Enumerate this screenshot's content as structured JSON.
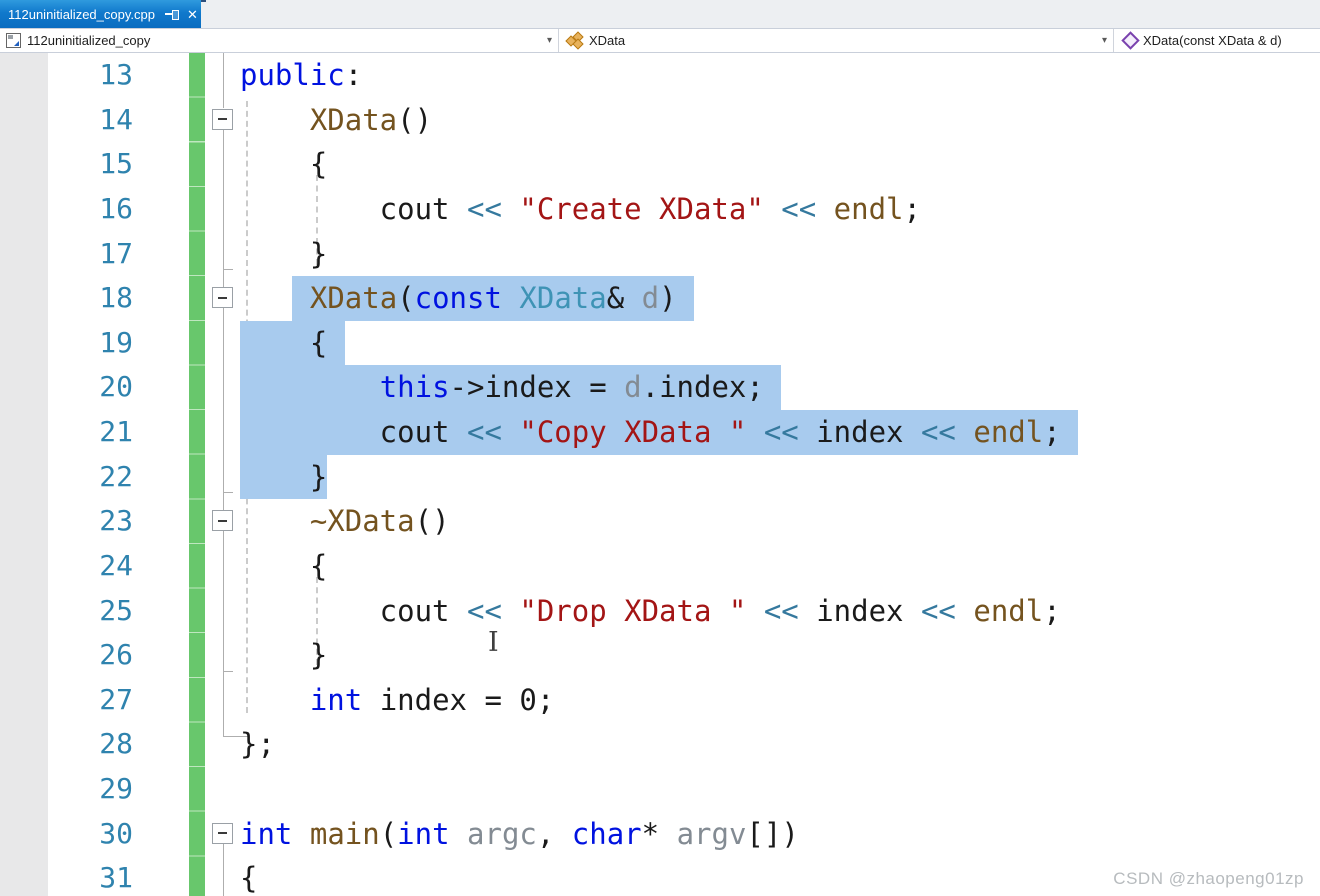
{
  "tab": {
    "title": "112uninitialized_copy.cpp",
    "close_glyph": "✕"
  },
  "navbar": {
    "scope_dropdown": {
      "label": "112uninitialized_copy",
      "icon": "cpp-project-item-icon",
      "arrow": "▾"
    },
    "type_dropdown": {
      "label": "XData",
      "icon": "class-icon",
      "arrow": "▾"
    },
    "member_dropdown": {
      "label": "XData(const XData & d)",
      "icon": "method-icon"
    }
  },
  "colors": {
    "tab_active_blue": "#0f76c8",
    "selection_blue": "#a8cbee",
    "change_bar_green": "#68c76c",
    "line_number_teal": "#2f83ae",
    "keyword": "#0012e0",
    "type": "#3e93b5",
    "function": "#74531f",
    "string": "#a31515",
    "operator": "#35799e",
    "parameter": "#838b93"
  },
  "editor": {
    "lines": [
      {
        "n": 13,
        "segments": [
          {
            "t": "public",
            "c": "keyword"
          },
          {
            "t": ":",
            "c": "plain"
          }
        ]
      },
      {
        "n": 14,
        "fold": true,
        "segments": [
          {
            "t": "    ",
            "c": "plain"
          },
          {
            "t": "XData",
            "c": "function"
          },
          {
            "t": "()",
            "c": "plain"
          }
        ]
      },
      {
        "n": 15,
        "segments": [
          {
            "t": "    {",
            "c": "plain"
          }
        ]
      },
      {
        "n": 16,
        "segments": [
          {
            "t": "        cout ",
            "c": "plain"
          },
          {
            "t": "<<",
            "c": "operator"
          },
          {
            "t": " ",
            "c": "plain"
          },
          {
            "t": "\"Create XData\"",
            "c": "string"
          },
          {
            "t": " ",
            "c": "plain"
          },
          {
            "t": "<<",
            "c": "operator"
          },
          {
            "t": " ",
            "c": "plain"
          },
          {
            "t": "endl",
            "c": "function"
          },
          {
            "t": ";",
            "c": "plain"
          }
        ]
      },
      {
        "n": 17,
        "segments": [
          {
            "t": "    }",
            "c": "plain"
          }
        ]
      },
      {
        "n": 18,
        "fold": true,
        "segments": [
          {
            "t": "   ",
            "c": "plain"
          },
          {
            "t": " ",
            "c": "plain",
            "sel": true
          },
          {
            "t": "XData",
            "c": "function",
            "sel": true
          },
          {
            "t": "(",
            "c": "plain",
            "sel": true
          },
          {
            "t": "const",
            "c": "keyword",
            "sel": true
          },
          {
            "t": " ",
            "c": "plain",
            "sel": true
          },
          {
            "t": "XData",
            "c": "type",
            "sel": true
          },
          {
            "t": "& ",
            "c": "plain",
            "sel": true
          },
          {
            "t": "d",
            "c": "param",
            "sel": true
          },
          {
            "t": ")",
            "c": "plain",
            "sel": true
          },
          {
            "t": " ",
            "c": "plain",
            "sel": true
          }
        ]
      },
      {
        "n": 19,
        "segments": [
          {
            "t": "    { ",
            "c": "plain",
            "sel": true
          }
        ]
      },
      {
        "n": 20,
        "segments": [
          {
            "t": "        ",
            "c": "plain",
            "sel": true
          },
          {
            "t": "this",
            "c": "keyword",
            "sel": true
          },
          {
            "t": "->index = ",
            "c": "plain",
            "sel": true
          },
          {
            "t": "d",
            "c": "param",
            "sel": true
          },
          {
            "t": ".index; ",
            "c": "plain",
            "sel": true
          }
        ]
      },
      {
        "n": 21,
        "segments": [
          {
            "t": "        cout ",
            "c": "plain",
            "sel": true
          },
          {
            "t": "<<",
            "c": "operator",
            "sel": true
          },
          {
            "t": " ",
            "c": "plain",
            "sel": true
          },
          {
            "t": "\"Copy XData \"",
            "c": "string",
            "sel": true
          },
          {
            "t": " ",
            "c": "plain",
            "sel": true
          },
          {
            "t": "<<",
            "c": "operator",
            "sel": true
          },
          {
            "t": " index ",
            "c": "plain",
            "sel": true
          },
          {
            "t": "<<",
            "c": "operator",
            "sel": true
          },
          {
            "t": " ",
            "c": "plain",
            "sel": true
          },
          {
            "t": "endl",
            "c": "function",
            "sel": true
          },
          {
            "t": "; ",
            "c": "plain",
            "sel": true
          }
        ]
      },
      {
        "n": 22,
        "segments": [
          {
            "t": "    }",
            "c": "plain",
            "sel": true
          }
        ]
      },
      {
        "n": 23,
        "fold": true,
        "segments": [
          {
            "t": "    ",
            "c": "plain"
          },
          {
            "t": "~XData",
            "c": "function"
          },
          {
            "t": "()",
            "c": "plain"
          }
        ]
      },
      {
        "n": 24,
        "segments": [
          {
            "t": "    {",
            "c": "plain"
          }
        ]
      },
      {
        "n": 25,
        "segments": [
          {
            "t": "        cout ",
            "c": "plain"
          },
          {
            "t": "<<",
            "c": "operator"
          },
          {
            "t": " ",
            "c": "plain"
          },
          {
            "t": "\"Drop XData \"",
            "c": "string"
          },
          {
            "t": " ",
            "c": "plain"
          },
          {
            "t": "<<",
            "c": "operator"
          },
          {
            "t": " index ",
            "c": "plain"
          },
          {
            "t": "<<",
            "c": "operator"
          },
          {
            "t": " ",
            "c": "plain"
          },
          {
            "t": "endl",
            "c": "function"
          },
          {
            "t": ";",
            "c": "plain"
          }
        ]
      },
      {
        "n": 26,
        "segments": [
          {
            "t": "    }",
            "c": "plain"
          }
        ]
      },
      {
        "n": 27,
        "segments": [
          {
            "t": "    ",
            "c": "plain"
          },
          {
            "t": "int",
            "c": "keyword"
          },
          {
            "t": " index = 0;",
            "c": "plain"
          }
        ]
      },
      {
        "n": 28,
        "segments": [
          {
            "t": "};",
            "c": "plain"
          }
        ]
      },
      {
        "n": 29,
        "segments": []
      },
      {
        "n": 30,
        "fold": true,
        "segments": [
          {
            "t": "int",
            "c": "keyword"
          },
          {
            "t": " ",
            "c": "plain"
          },
          {
            "t": "main",
            "c": "function"
          },
          {
            "t": "(",
            "c": "plain"
          },
          {
            "t": "int",
            "c": "keyword"
          },
          {
            "t": " ",
            "c": "plain"
          },
          {
            "t": "argc",
            "c": "param"
          },
          {
            "t": ", ",
            "c": "plain"
          },
          {
            "t": "char",
            "c": "keyword"
          },
          {
            "t": "* ",
            "c": "plain"
          },
          {
            "t": "argv",
            "c": "param"
          },
          {
            "t": "[])",
            "c": "plain"
          }
        ]
      },
      {
        "n": 31,
        "segments": [
          {
            "t": "{",
            "c": "plain"
          }
        ]
      }
    ]
  },
  "watermark": "CSDN @zhaopeng01zp"
}
